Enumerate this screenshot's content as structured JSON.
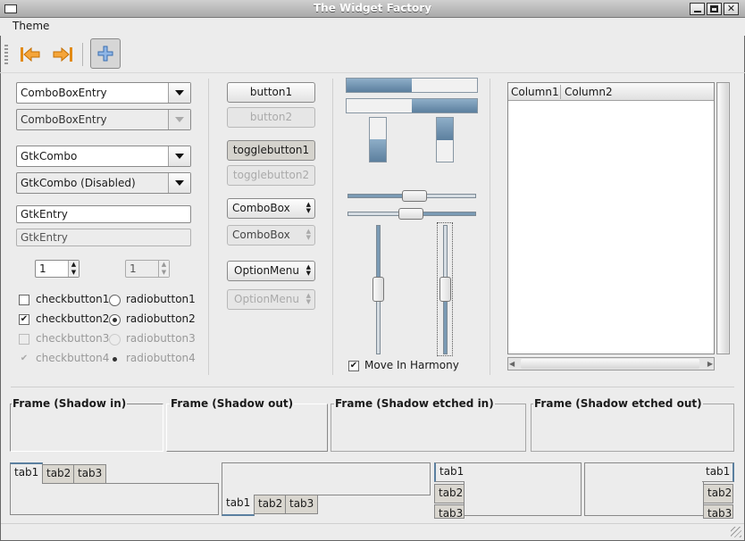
{
  "window": {
    "title": "The Widget Factory"
  },
  "menu": {
    "items": [
      "Theme"
    ]
  },
  "toolbar": {
    "back": "go-back-icon",
    "forward": "go-forward-icon",
    "add": "add-icon"
  },
  "column1": {
    "combo_entry_1": "ComboBoxEntry",
    "combo_entry_2": "ComboBoxEntry",
    "gtkcombo_1": "GtkCombo",
    "gtkcombo_2": "GtkCombo (Disabled)",
    "entry_1": "GtkEntry",
    "entry_2": "GtkEntry",
    "spin_1": "1",
    "spin_2": "1",
    "checks": [
      {
        "label": "checkbutton1",
        "checked": false,
        "disabled": false
      },
      {
        "label": "checkbutton2",
        "checked": true,
        "disabled": false
      },
      {
        "label": "checkbutton3",
        "checked": false,
        "disabled": true
      },
      {
        "label": "checkbutton4",
        "checked": true,
        "disabled": true
      }
    ],
    "radios": [
      {
        "label": "radiobutton1",
        "selected": false,
        "disabled": false
      },
      {
        "label": "radiobutton2",
        "selected": true,
        "disabled": false
      },
      {
        "label": "radiobutton3",
        "selected": false,
        "disabled": true
      },
      {
        "label": "radiobutton4",
        "selected": true,
        "disabled": true
      }
    ]
  },
  "column2": {
    "button1": "button1",
    "button2": "button2",
    "toggle1": "togglebutton1",
    "toggle2": "togglebutton2",
    "combobox1": "ComboBox",
    "combobox2": "ComboBox",
    "option1": "OptionMenu",
    "option2": "OptionMenu"
  },
  "column3": {
    "progress_h1": 0.5,
    "progress_h2": 0.5,
    "progress_v1": 0.5,
    "progress_v2": 0.5,
    "move_in_harmony": "Move In Harmony",
    "move_in_harmony_checked": true
  },
  "tree": {
    "columns": [
      "Column1",
      "Column2"
    ]
  },
  "frames": [
    "Frame (Shadow in)",
    "Frame (Shadow out)",
    "Frame (Shadow etched in)",
    "Frame (Shadow etched out)"
  ],
  "tabs": [
    "tab1",
    "tab2",
    "tab3"
  ]
}
